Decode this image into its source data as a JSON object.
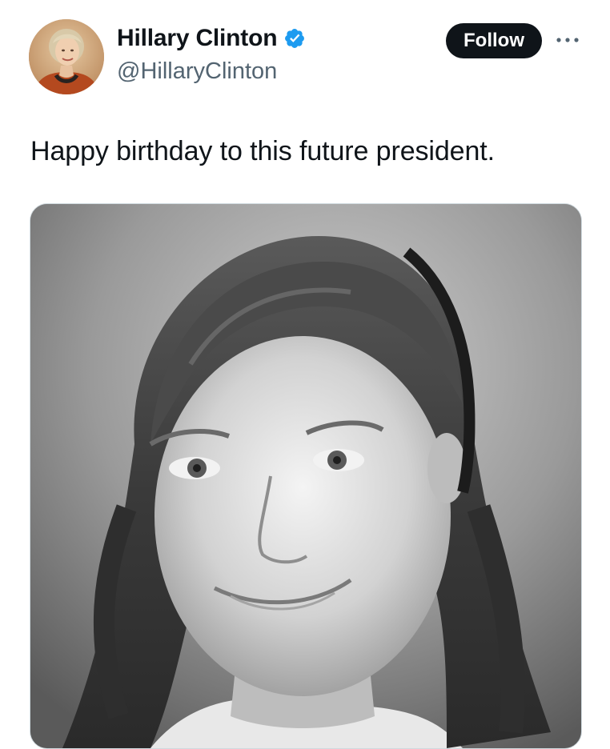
{
  "author": {
    "display_name": "Hillary Clinton",
    "handle": "@HillaryClinton",
    "verified": true,
    "verified_color": "#1d9bf0"
  },
  "actions": {
    "follow_label": "Follow",
    "more_icon": "more-horizontal-icon"
  },
  "post": {
    "text": "Happy birthday to this future president.",
    "media_type": "photo",
    "media_style": "black-and-white"
  },
  "colors": {
    "text_primary": "#0f1419",
    "text_secondary": "#536471",
    "follow_bg": "#0f1419",
    "follow_text": "#ffffff"
  }
}
